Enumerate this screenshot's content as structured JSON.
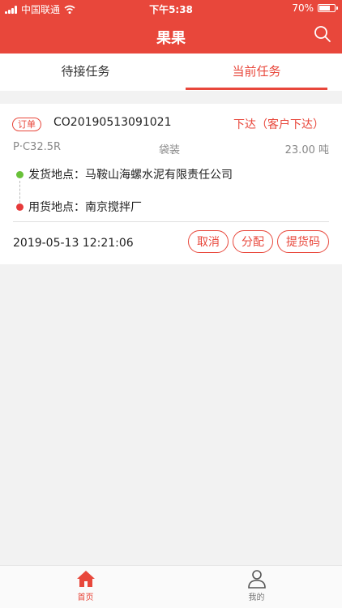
{
  "status_bar": {
    "carrier": "中国联通",
    "time": "下午5:38",
    "battery": "70%",
    "battery_level": 0.7
  },
  "header": {
    "title": "果果",
    "search_icon": "search-icon"
  },
  "tabs": [
    {
      "label": "待接任务",
      "active": false
    },
    {
      "label": "当前任务",
      "active": true
    }
  ],
  "order": {
    "badge": "订单",
    "number": "CO20190513091021",
    "status": "下达（客户下达）",
    "product": "P·C32.5R",
    "packaging": "袋装",
    "quantity": "23.00 吨",
    "origin": "发货地点：马鞍山海螺水泥有限责任公司",
    "destination": "用货地点：南京搅拌厂",
    "time": "2019-05-13 12:21:06",
    "actions": {
      "cancel": "取消",
      "assign": "分配",
      "pickup_code": "提货码"
    }
  },
  "bottom_nav": [
    {
      "label": "首页",
      "icon": "home-icon",
      "active": true
    },
    {
      "label": "我的",
      "icon": "user-icon",
      "active": false
    }
  ],
  "colors": {
    "accent": "#e8473b",
    "origin_dot": "#69c139",
    "destination_dot": "#e63a3a"
  }
}
